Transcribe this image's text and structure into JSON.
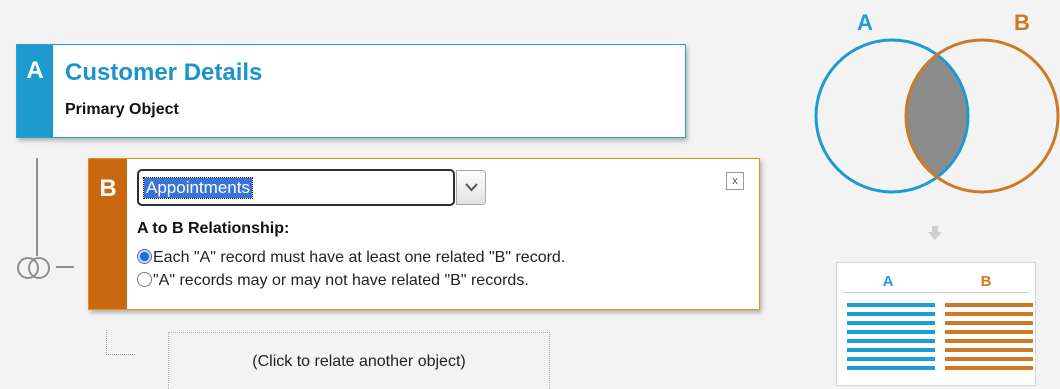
{
  "primary": {
    "badge": "A",
    "title": "Customer Details",
    "subtitle": "Primary Object"
  },
  "related": {
    "badge": "B",
    "selected_object": "Appointments",
    "close_label": "x",
    "relationship_label": "A to B Relationship:",
    "options": [
      {
        "label": "Each \"A\" record must have at least one related \"B\" record.",
        "selected": true
      },
      {
        "label": "\"A\" records may or may not have related \"B\" records.",
        "selected": false
      }
    ]
  },
  "add_object_label": "(Click to relate another object)",
  "venn": {
    "label_a": "A",
    "label_b": "B"
  },
  "result_table": {
    "header_a": "A",
    "header_b": "B"
  },
  "colors": {
    "a_accent": "#1d9bd1",
    "b_accent": "#c96810",
    "intersection": "#8c8c8c"
  },
  "icons": {
    "join": "join-icon",
    "dropdown": "chevron-down-icon",
    "close": "close-icon",
    "arrow": "arrow-down-icon"
  }
}
